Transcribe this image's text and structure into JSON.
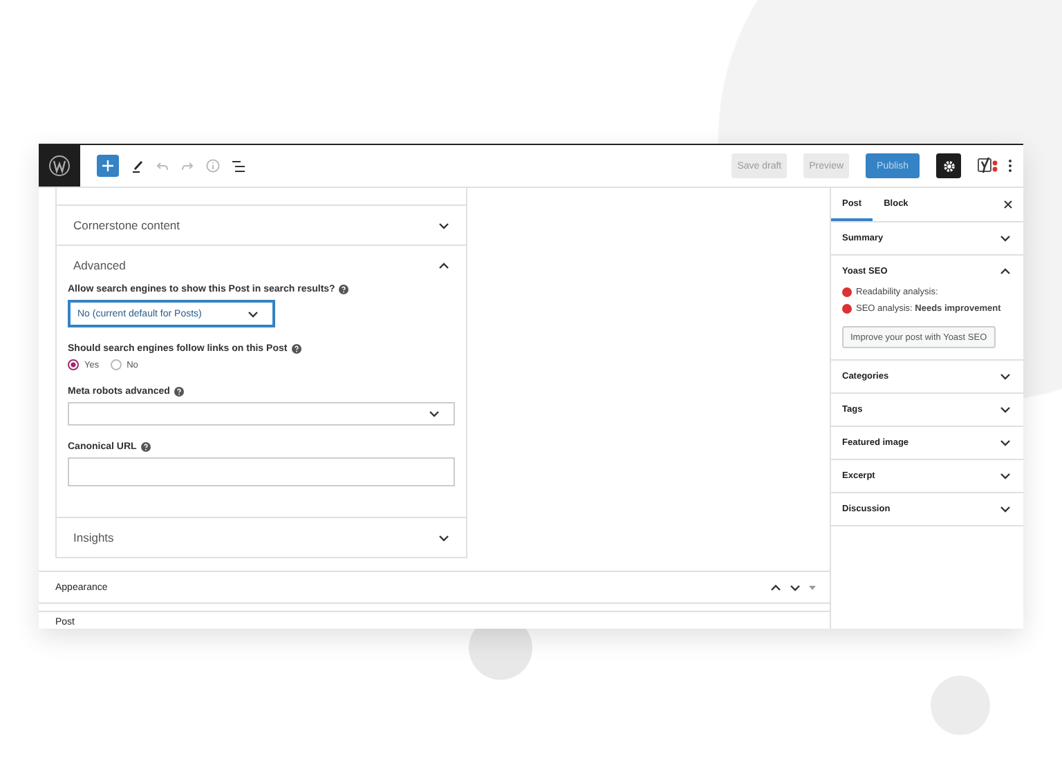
{
  "topbar": {
    "buttons": [
      {
        "label": "Save draft",
        "kind": "secondary"
      },
      {
        "label": "Preview",
        "kind": "secondary"
      },
      {
        "label": "Publish",
        "kind": "primary"
      }
    ],
    "settings_active": true
  },
  "metabox": {
    "sections": [
      {
        "title": "Cornerstone content",
        "expanded": false
      },
      {
        "title": "Advanced",
        "expanded": true,
        "fields": [
          {
            "kind": "select",
            "label": "Allow search engines to show this Post in search results?",
            "value": "No (current default for Posts)",
            "focused": true
          },
          {
            "kind": "radio",
            "label": "Should search engines follow links on this Post",
            "options": [
              {
                "label": "Yes",
                "selected": true
              },
              {
                "label": "No",
                "selected": false
              }
            ]
          },
          {
            "kind": "select",
            "label": "Meta robots advanced",
            "focused": false
          },
          {
            "kind": "text",
            "label": "Canonical URL"
          }
        ]
      },
      {
        "title": "Insights",
        "expanded": false
      }
    ]
  },
  "bottom_panels": [
    {
      "title": "Appearance"
    },
    {
      "title": "Post"
    }
  ],
  "sidebar": {
    "tabs": [
      {
        "label": "Post",
        "selected": true
      },
      {
        "label": "Block",
        "selected": false
      }
    ],
    "panels": [
      {
        "title": "Summary",
        "expanded": false
      },
      {
        "title": "Yoast SEO",
        "expanded": true,
        "analyses": [
          {
            "text": "Readability analysis:",
            "color": "#dc3232"
          },
          {
            "text": "SEO analysis: **Needs improvement**",
            "color": "#dc3232"
          }
        ],
        "button": "Improve your post with Yoast SEO"
      },
      {
        "title": "Categories",
        "expanded": false
      },
      {
        "title": "Tags",
        "expanded": false
      },
      {
        "title": "Featured image",
        "expanded": false
      },
      {
        "title": "Excerpt",
        "expanded": false
      },
      {
        "title": "Discussion",
        "expanded": false
      }
    ]
  }
}
